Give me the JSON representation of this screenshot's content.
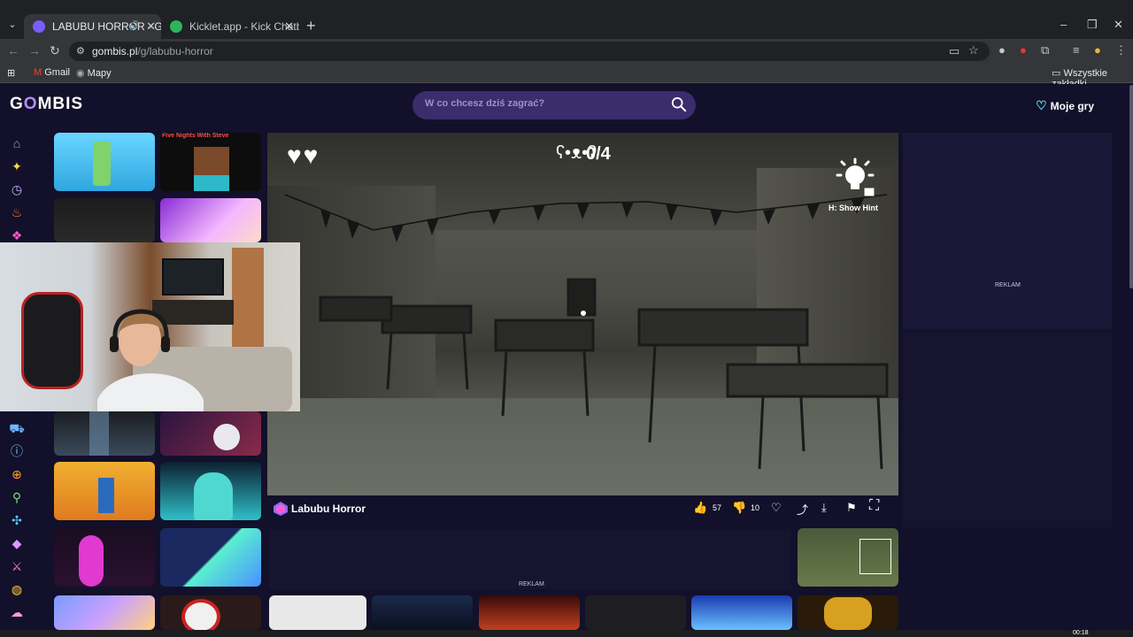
{
  "browser": {
    "tabs": [
      {
        "title": "LABUBU HORROR - Graj w",
        "active": true
      },
      {
        "title": "Kicklet.app - Kick Chatbot and",
        "active": false
      }
    ],
    "url_domain": "gombis.pl",
    "url_path": "/g/labubu-horror",
    "bookmarks": [
      "Gmail",
      "Mapy"
    ],
    "all_bookmarks": "Wszystkie zakładki"
  },
  "site": {
    "logo_prefix": "G",
    "logo_o": "O",
    "logo_suffix": "MBIS",
    "search_placeholder": "W co chcesz dziś zagrać?",
    "my_games": "Moje gry"
  },
  "game": {
    "title": "Labubu Horror",
    "counter": "0/4",
    "hint": "H: Show Hint",
    "likes": "57",
    "dislikes": "10"
  },
  "thumbnails": {
    "minecraft_label": "Five Nights With Steve"
  },
  "ads": {
    "label_right": "REKLAM",
    "label_mid": "REKLAM"
  },
  "taskbar": {
    "clock": "00:18"
  },
  "colors": {
    "page_bg": "#12102a",
    "search_bg": "#3b2c6e",
    "accent": "#b48cff",
    "heart_accent": "#5ce1e6"
  }
}
